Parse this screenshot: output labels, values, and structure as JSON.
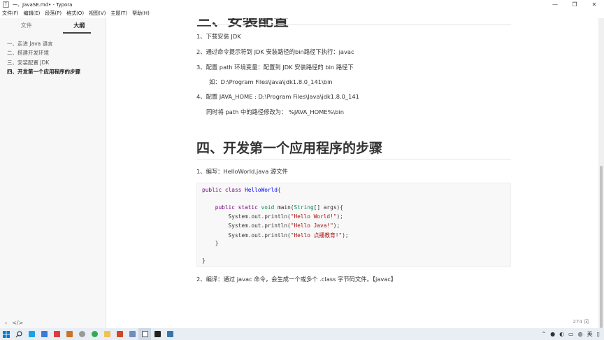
{
  "window": {
    "title": "一、JavaSE.md• - Typora",
    "controls": [
      "—",
      "❐",
      "✕"
    ]
  },
  "menu": [
    "文件(F)",
    "编辑(E)",
    "段落(P)",
    "格式(O)",
    "视图(V)",
    "主题(T)",
    "帮助(H)"
  ],
  "sidebar": {
    "tabs": [
      "文件",
      "大纲"
    ],
    "outline": [
      "一、走进 Java 语言",
      "二、搭建开发环境",
      "三、安装配置 JDK",
      "四、开发第一个应用程序的步骤"
    ],
    "footer_icons": [
      "‹",
      "</>"
    ]
  },
  "doc": {
    "cut_heading": "三、安装配置",
    "steps": [
      "1、下载安装 JDK",
      "2、通过命令提示符到 JDK 安装路径的bin路径下执行：javac",
      "3、配置 path 环境变量：配置到 JDK 安装路径的 bin 路径下"
    ],
    "path_example": "如：D:\\Program Files\\Java\\jdk1.8.0_141\\bin",
    "step4": "4、配置 JAVA_HOME : D:\\Program Files\\Java\\jdk1.8.0_141",
    "step4_note": "同时将 path 中的路径修改为： %JAVA_HOME%\\bin",
    "h2": "四、开发第一个应用程序的步骤",
    "s1": "1、编写：HelloWorld.java 源文件",
    "code": {
      "line1": [
        "public",
        " ",
        "class",
        " ",
        "HelloWorld",
        "{"
      ],
      "line3": [
        "    ",
        "public",
        " ",
        "static",
        " ",
        "void",
        " main(",
        "String",
        "[] args){"
      ],
      "line4": [
        "        System.out.println(",
        "\"Hello World!\"",
        ");"
      ],
      "line5": [
        "        System.out.println(",
        "\"Hello Java!\"",
        ");"
      ],
      "line6": [
        "        System.out.println(",
        "\"Hello 点播教育!\"",
        ");"
      ],
      "line7": "    }",
      "line9": "}"
    },
    "s2": "2、编译：通过 javac 命令，会生成一个或多个 .class 字节码文件。【javac】"
  },
  "status": {
    "word_count": "274 词"
  },
  "taskbar": {
    "icons": [
      "windows-start",
      "search",
      "qq",
      "video",
      "game",
      "fox",
      "chrome",
      "folder",
      "office",
      "app",
      "typora",
      "terminal",
      "python"
    ],
    "tray": [
      "⌃",
      "●",
      "◐",
      "▭",
      "◍",
      "英",
      "▯"
    ]
  },
  "colors": {
    "sidebar_bg": "#f7f7f7",
    "code_bg": "#f8f8f8",
    "keyword": "#770088",
    "type": "#008855",
    "def": "#0000ff",
    "string": "#aa1111"
  }
}
